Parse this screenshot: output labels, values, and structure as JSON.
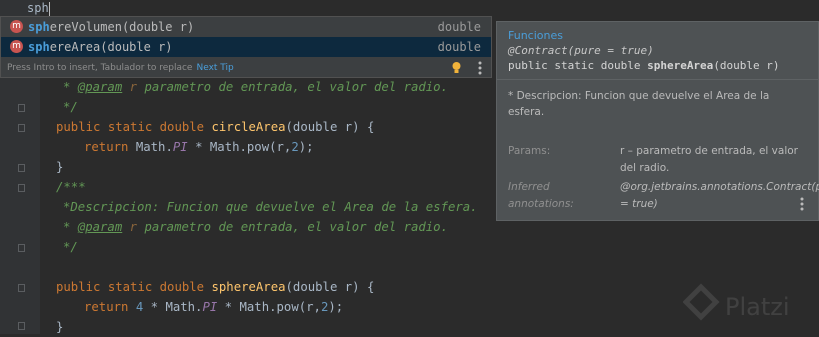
{
  "editor": {
    "typed_text": "sph",
    "lines": {
      "l1_param_tag": "@param",
      "l1_param_name": "r",
      "l1_rest": "parametro de entrada, el valor del radio.",
      "l2": "*/",
      "l3_kw1": "public",
      "l3_kw2": "static",
      "l3_type": "double",
      "l3_fn": "circleArea",
      "l3_sig": "(double r) {",
      "l4_kw": "return",
      "l4_a": "Math.",
      "l4_pi": "PI",
      "l4_b": " * Math.",
      "l4_pow": "pow",
      "l4_args": "(r,",
      "l4_num": "2",
      "l4_end": ");",
      "l5": "}",
      "l6": "/***",
      "l7": "*Descripcion: Funcion que devuelve el Area de la esfera.",
      "l8_tag": "@param",
      "l8_name": "r",
      "l8_rest": "parametro de entrada, el valor del radio.",
      "l9": "*/",
      "l11_kw1": "public",
      "l11_kw2": "static",
      "l11_type": "double",
      "l11_fn": "sphereArea",
      "l11_sig": "(double r) {",
      "l12_kw": "return",
      "l12_num1": "4",
      "l12_a": " * Math.",
      "l12_pi": "PI",
      "l12_b": " * Math.",
      "l12_pow": "pow",
      "l12_args": "(r,",
      "l12_num2": "2",
      "l12_end": ");",
      "l13": "}"
    }
  },
  "completion": {
    "items": [
      {
        "match": "sph",
        "rest": "ereVolumen",
        "params": "(double r)",
        "type": "double",
        "badge": "m",
        "selected": false
      },
      {
        "match": "sph",
        "rest": "ereArea",
        "params": "(double r)",
        "type": "double",
        "badge": "m",
        "selected": true
      }
    ],
    "hint_text": "Press Intro to insert, Tabulador to replace",
    "hint_link": "Next Tip"
  },
  "doc": {
    "class_name": "Funciones",
    "annotation": "@Contract(pure = true)",
    "signature_prefix": "public static double ",
    "signature_name": "sphereArea",
    "signature_suffix": "(double r)",
    "description": "* Descripcion: Funcion que devuelve el Area de la esfera.",
    "params_label": "Params:",
    "params_value": "r – parametro de entrada, el valor del radio.",
    "inferred_label": "Inferred annotations:",
    "inferred_value": "@org.jetbrains.annotations.Contract(pure = true)"
  },
  "colors": {
    "accent": "#4a9eda",
    "selected_row": "#0d293e",
    "badge": "#c75450"
  },
  "watermark": "Platzi"
}
